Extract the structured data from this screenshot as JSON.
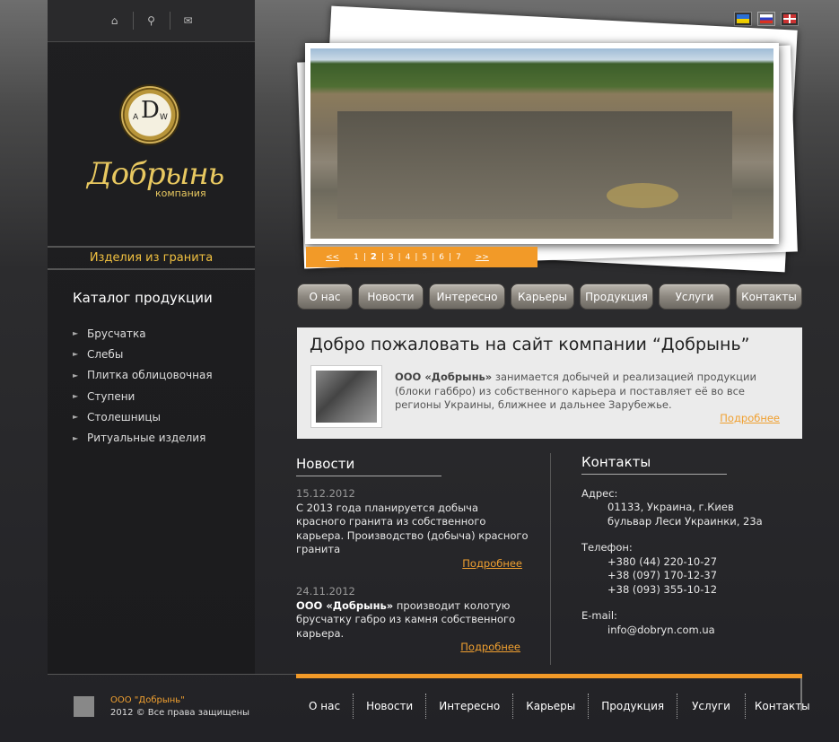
{
  "header": {
    "icons": [
      "home-icon",
      "search-icon",
      "mail-icon"
    ],
    "languages": [
      {
        "code": "ua",
        "active": false
      },
      {
        "code": "ru",
        "active": true
      },
      {
        "code": "en",
        "active": false
      }
    ]
  },
  "logo": {
    "medal_main": "D",
    "medal_left": "A",
    "medal_right": "W",
    "brand": "Добрынь",
    "brand_sub": "компания"
  },
  "sidebar": {
    "section_bar": "Изделия из гранита",
    "catalog_title": "Каталог  продукции",
    "items": [
      {
        "label": "Брусчатка"
      },
      {
        "label": "Слебы"
      },
      {
        "label": "Плитка  облицовочная"
      },
      {
        "label": "Ступени"
      },
      {
        "label": "Столешницы"
      },
      {
        "label": "Ритуальные изделия"
      }
    ]
  },
  "slider": {
    "prev": "<<",
    "next": ">>",
    "pages": [
      "1",
      "2",
      "3",
      "4",
      "5",
      "6",
      "7"
    ],
    "current": "2"
  },
  "topnav": [
    {
      "label": "О нас",
      "w": 62
    },
    {
      "label": "Новости",
      "w": 73
    },
    {
      "label": "Интересно",
      "w": 85
    },
    {
      "label": "Карьеры",
      "w": 71
    },
    {
      "label": "Продукция",
      "w": 82
    },
    {
      "label": "Услуги",
      "w": 80
    },
    {
      "label": "Контакты",
      "w": 74
    }
  ],
  "welcome": {
    "title": "Добро пожаловать на сайт компании “Добрынь”",
    "company": "ООО «Добрынь»",
    "text": " занимается добычей и реализацией продукции (блоки габбро) из собственного карьера и поставляет её во все регионы Украины, ближнее и дальнее Зарубежье.",
    "more": "Подробнее"
  },
  "news": {
    "title": "Новости",
    "items": [
      {
        "date": "15.12.2012",
        "company": "",
        "text": "С 2013 года планируется добыча красного гранита из собственного карьера. Производство (добыча) красного гранита",
        "more": "Подробнее"
      },
      {
        "date": "24.11.2012",
        "company": "ООО «Добрынь»",
        "text": " производит колотую брусчатку габро из камня собственного карьера.",
        "more": "Подробнее"
      }
    ]
  },
  "contacts": {
    "title": "Контакты",
    "address_label": "Адрес:",
    "address_line1": "01133, Украина, г.Киев",
    "address_line2": "бульвар Леси Украинки, 23а",
    "phone_label": "Телефон:",
    "phones": [
      "+380 (44) 220-10-27",
      "+38 (097) 170-12-37",
      "+38 (093) 355-10-12"
    ],
    "email_label": "E-mail:",
    "email": "info@dobryn.com.ua"
  },
  "footer": {
    "company": "ООО \"Добрынь\"",
    "copyright": "2012 © Все права защищены",
    "nav": [
      "О нас",
      "Новости",
      "Интересно",
      "Карьеры",
      "Продукция",
      "Услуги",
      "Контакты"
    ]
  }
}
